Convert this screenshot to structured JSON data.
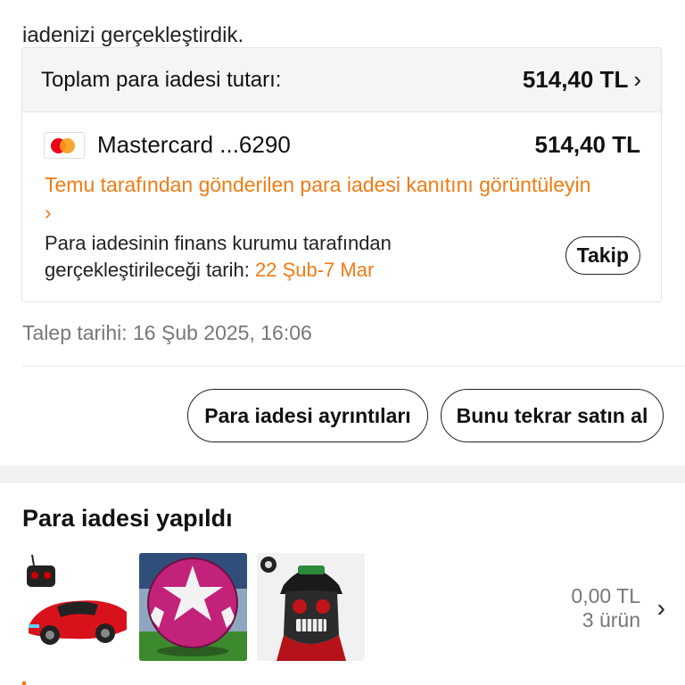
{
  "intro_text": "iadenizi gerçekleştirdik.",
  "refund_card": {
    "total_label": "Toplam para iadesi tutarı:",
    "total_amount": "514,40 TL",
    "card_name": "Mastercard ...6290",
    "card_amount": "514,40 TL",
    "proof_link": "Temu tarafından gönderilen para iadesi kanıtını görüntüleyin",
    "finance_text": "Para iadesinin finans kurumu tarafından gerçekleştirileceği tarih:",
    "finance_date": "22 Şub-7 Mar",
    "track_button": "Takip"
  },
  "request_date": "Talep tarihi: 16 Şub 2025, 16:06",
  "actions": {
    "details_button": "Para iadesi ayrıntıları",
    "rebuy_button": "Bunu tekrar satın al"
  },
  "refunded_section": {
    "title": "Para iadesi yapıldı",
    "amount": "0,00 TL",
    "count": "3 ürün",
    "items": [
      "rc-car-image",
      "soccer-ball-image",
      "skull-mask-image"
    ]
  },
  "colors": {
    "accent": "#f07b13",
    "mastercard_red": "#eb001b",
    "mastercard_orange": "#f79e1b"
  }
}
